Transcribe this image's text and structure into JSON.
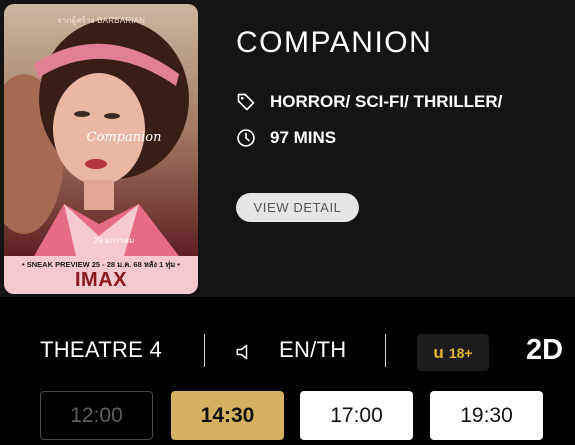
{
  "movie": {
    "title": "COMPANION",
    "genre": "HORROR/ SCI-FI/ THRILLER/",
    "runtime": "97 MINS",
    "view_detail_label": "VIEW DETAIL",
    "icons": {
      "genre": "tag-icon",
      "runtime": "clock-icon"
    }
  },
  "poster": {
    "tagline": "จากผู้สร้าง BARBARIAN",
    "thai_title": "Companion",
    "release_date": "29 มกราคม",
    "sneak_preview": "• SNEAK PREVIEW 25 - 28 ม.ค. 68 หลัง 1 ทุ่ม •",
    "imax_label": "IMAX"
  },
  "showing": {
    "theatre": "THEATRE 4",
    "language": "EN/TH",
    "rating_prefix": "u",
    "rating_age": "18+",
    "format": "2D",
    "icons": {
      "language": "speaker-icon"
    }
  },
  "showtimes": [
    {
      "time": "12:00",
      "state": "disabled"
    },
    {
      "time": "14:30",
      "state": "selected"
    },
    {
      "time": "17:00",
      "state": "available"
    },
    {
      "time": "19:30",
      "state": "available"
    }
  ],
  "colors": {
    "background": "#000000",
    "card": "#141414",
    "selected_showtime": "#d5b060",
    "rating_text": "#e3b431",
    "poster_strip": "#f6c8cf",
    "imax_text": "#8a1820"
  }
}
